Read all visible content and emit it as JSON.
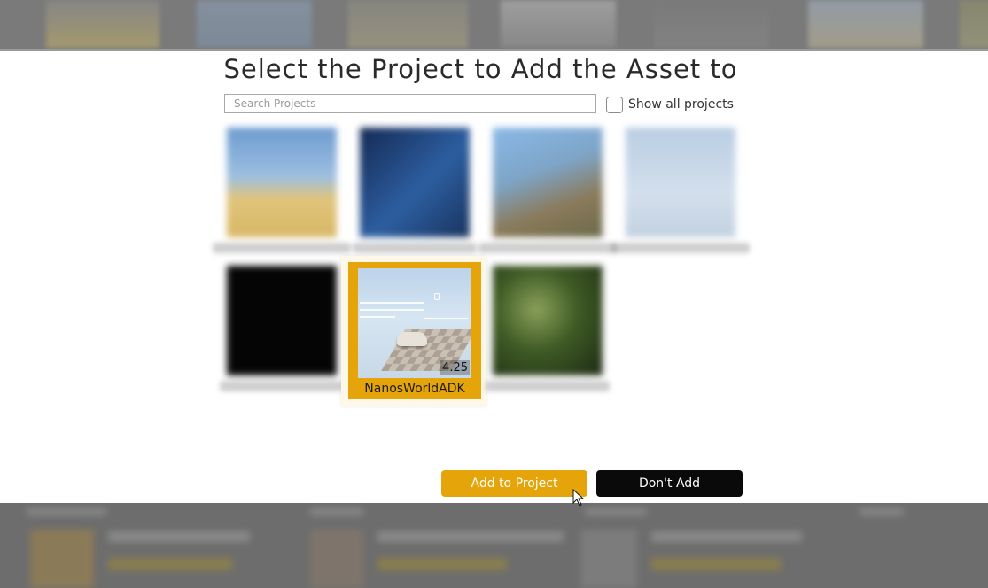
{
  "dialog": {
    "title": "Select the Project to Add the Asset to",
    "search_placeholder": "Search Projects",
    "search_value": "",
    "show_all_label": "Show all projects",
    "show_all_checked": false
  },
  "projects": [
    {
      "name": "",
      "color": "#5b8fc7",
      "color2": "#e2c47a"
    },
    {
      "name": "",
      "color": "#1f3f75",
      "color2": "#3a6fb0"
    },
    {
      "name": "",
      "color": "#6ea2d6",
      "color2": "#8a7a5a"
    },
    {
      "name": "",
      "color": "#a7bfda",
      "color2": "#c9d6e6"
    },
    {
      "name": "",
      "color": "#050505",
      "color2": "#111111"
    },
    {
      "name": "",
      "color": "#2a3a1a",
      "color2": "#6a8a3a"
    }
  ],
  "selected_project": {
    "name": "NanosWorldADK",
    "version": "4.25"
  },
  "buttons": {
    "add": "Add to Project",
    "cancel": "Don't Add"
  },
  "colors": {
    "accent": "#e5a50a",
    "dark_button": "#0a0a0a"
  }
}
